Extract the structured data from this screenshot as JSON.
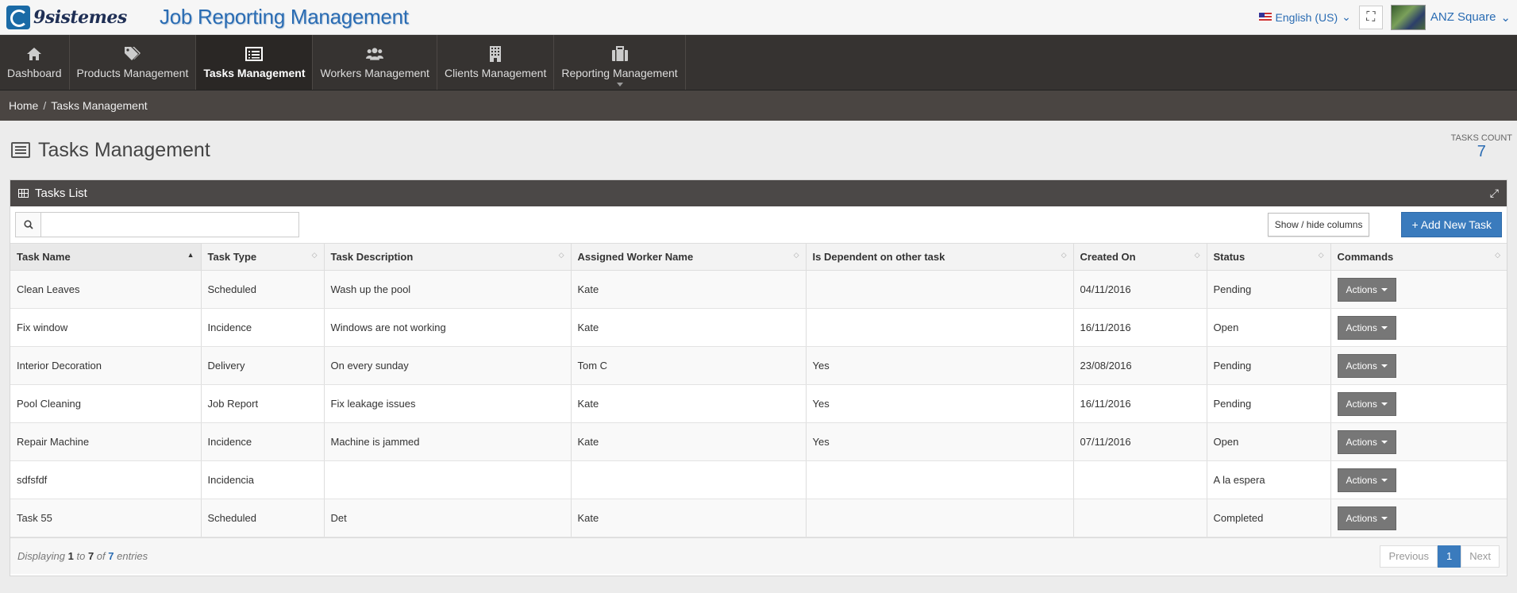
{
  "header": {
    "logo_text": "9sistemes",
    "app_title": "Job Reporting Management",
    "language": "English (US)",
    "user_name": "ANZ Square"
  },
  "nav": {
    "items": [
      {
        "label": "Dashboard",
        "icon": "home-icon"
      },
      {
        "label": "Products Management",
        "icon": "tags-icon"
      },
      {
        "label": "Tasks Management",
        "icon": "list-icon",
        "active": true
      },
      {
        "label": "Workers Management",
        "icon": "users-icon"
      },
      {
        "label": "Clients Management",
        "icon": "building-icon"
      },
      {
        "label": "Reporting Management",
        "icon": "briefcase-icon"
      }
    ]
  },
  "breadcrumb": {
    "home": "Home",
    "separator": "/",
    "current": "Tasks Management"
  },
  "page": {
    "title": "Tasks Management",
    "count_label": "TASKS COUNT",
    "count_value": "7"
  },
  "panel": {
    "title": "Tasks List",
    "search_placeholder": "",
    "show_hide_label": "Show / hide columns",
    "add_label": "+ Add New Task",
    "columns": [
      "Task Name",
      "Task Type",
      "Task Description",
      "Assigned Worker Name",
      "Is Dependent on other task",
      "Created On",
      "Status",
      "Commands"
    ],
    "rows": [
      [
        "Clean Leaves",
        "Scheduled",
        "Wash up the pool",
        "Kate",
        "",
        "04/11/2016",
        "Pending"
      ],
      [
        "Fix window",
        "Incidence",
        "Windows are not working",
        "Kate",
        "",
        "16/11/2016",
        "Open"
      ],
      [
        "Interior Decoration",
        "Delivery",
        "On every sunday",
        "Tom C",
        "Yes",
        "23/08/2016",
        "Pending"
      ],
      [
        "Pool Cleaning",
        "Job Report",
        "Fix leakage issues",
        "Kate",
        "Yes",
        "16/11/2016",
        "Pending"
      ],
      [
        "Repair Machine",
        "Incidence",
        "Machine is jammed",
        "Kate",
        "Yes",
        "07/11/2016",
        "Open"
      ],
      [
        "sdfsfdf",
        "Incidencia",
        "",
        "",
        "",
        "",
        "A la espera"
      ],
      [
        "Task 55",
        "Scheduled",
        "Det",
        "Kate",
        "",
        "",
        "Completed"
      ]
    ],
    "actions_label": "Actions",
    "footer": {
      "displaying": "Displaying",
      "from": "1",
      "to_word": "to",
      "to": "7",
      "of_word": "of",
      "total": "7",
      "entries_word": "entries"
    },
    "pager": {
      "previous": "Previous",
      "current": "1",
      "next": "Next"
    }
  },
  "colors": {
    "accent": "#3a7bbd",
    "nav_bg": "#363331",
    "title_blue": "#2a6cb3"
  }
}
